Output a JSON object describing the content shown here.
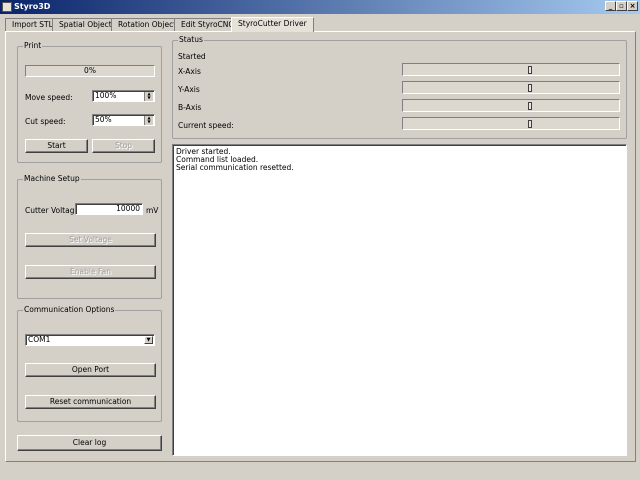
{
  "window": {
    "title": "Styro3D",
    "icon": "app-icon",
    "controls": [
      "_",
      "▫",
      "×"
    ]
  },
  "tabs": [
    {
      "label": "Import STL"
    },
    {
      "label": "Spatial Object"
    },
    {
      "label": "Rotation Object"
    },
    {
      "label": "Edit StyroCNC"
    },
    {
      "label": "StyroCutter Driver"
    }
  ],
  "active_tab": "StyroCutter Driver",
  "print": {
    "title": "Print",
    "progress_text": "0%",
    "progress_value": 0,
    "move_speed_label": "Move speed:",
    "move_speed_value": "100%",
    "cut_speed_label": "Cut speed:",
    "cut_speed_value": "50%",
    "start_label": "Start",
    "stop_label": "Stop"
  },
  "machine_setup": {
    "title": "Machine Setup",
    "voltage_label": "Cutter Voltage:",
    "voltage_value": "10000",
    "voltage_unit": "mV",
    "set_voltage_label": "Set Voltage",
    "enable_fan_label": "Enable Fan"
  },
  "communication": {
    "title": "Communication Options",
    "port_value": "COM1",
    "open_port_label": "Open Port",
    "reset_label": "Reset communication"
  },
  "clear_log_label": "Clear log",
  "status": {
    "title": "Status",
    "state": "Started",
    "x_label": "X-Axis",
    "y_label": "Y-Axis",
    "b_label": "B-Axis",
    "speed_label": "Current speed:"
  },
  "log": [
    "Driver started.",
    "Command list loaded.",
    "Serial communication resetted."
  ]
}
